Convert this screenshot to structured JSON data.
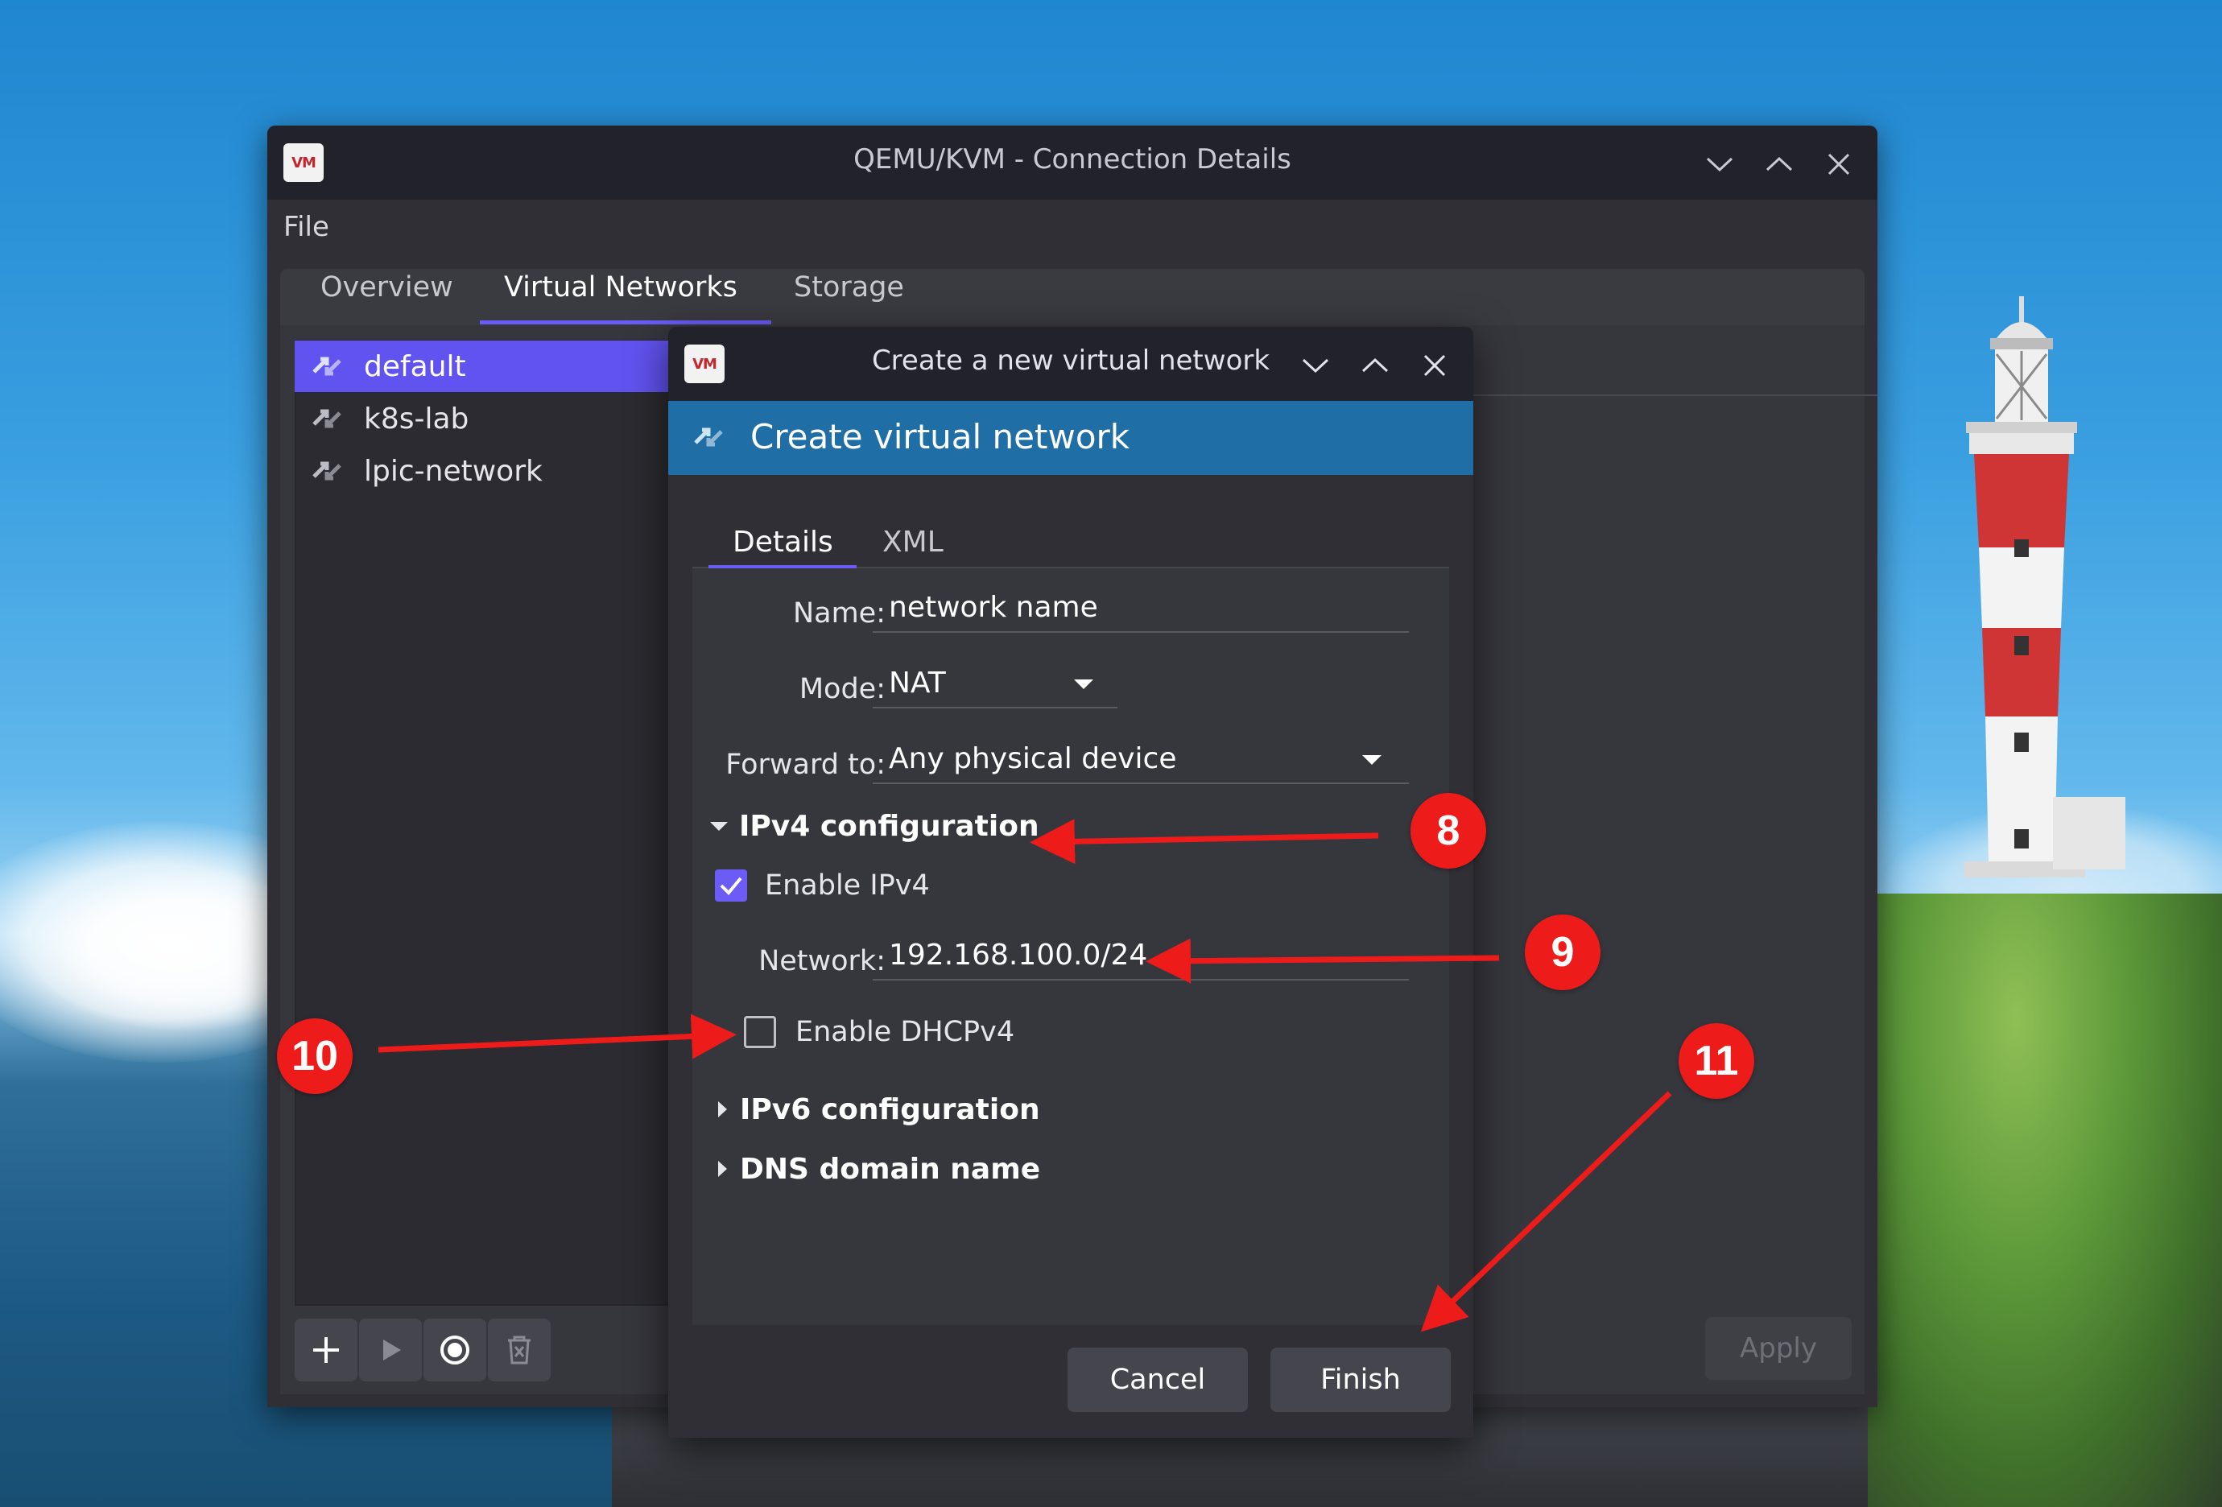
{
  "main_window": {
    "title": "QEMU/KVM - Connection Details",
    "app_icon_text": "VM",
    "menu": {
      "file": "File"
    },
    "tabs": [
      {
        "label": "Overview"
      },
      {
        "label": "Virtual Networks",
        "active": true
      },
      {
        "label": "Storage"
      }
    ],
    "networks": [
      {
        "name": "default",
        "selected": true
      },
      {
        "name": "k8s-lab"
      },
      {
        "name": "lpic-network"
      }
    ],
    "toolbar_icons": [
      "add-icon",
      "play-icon",
      "stop-icon",
      "delete-icon"
    ],
    "apply_label": "Apply"
  },
  "dialog": {
    "title": "Create a new virtual network",
    "app_icon_text": "VM",
    "banner": "Create virtual network",
    "tabs": [
      {
        "label": "Details",
        "active": true
      },
      {
        "label": "XML"
      }
    ],
    "name_label": "Name:",
    "name_value": "network name",
    "mode_label": "Mode:",
    "mode_value": "NAT",
    "forward_label": "Forward to:",
    "forward_value": "Any physical device",
    "ipv4_section": "IPv4 configuration",
    "ipv4_expanded": true,
    "enable_ipv4_label": "Enable IPv4",
    "enable_ipv4_checked": true,
    "network_label": "Network:",
    "network_value": "192.168.100.0/24",
    "enable_dhcp_label": "Enable DHCPv4",
    "enable_dhcp_checked": false,
    "ipv6_section": "IPv6 configuration",
    "dns_section": "DNS domain name",
    "cancel_label": "Cancel",
    "finish_label": "Finish"
  },
  "annotations": [
    {
      "number": "8"
    },
    {
      "number": "9"
    },
    {
      "number": "10"
    },
    {
      "number": "11"
    }
  ],
  "colors": {
    "accent": "#6b5cf6",
    "banner": "#1f6fa6",
    "annotation_red": "#ee1b1b"
  }
}
